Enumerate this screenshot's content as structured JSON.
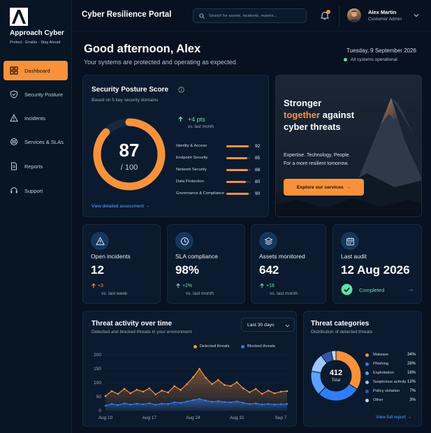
{
  "brand": {
    "name": "Approach Cyber",
    "tagline": "Protect  ·  Enable  ·  Stay Ahead"
  },
  "nav": [
    {
      "label": "Dashboard",
      "icon": "grid-icon",
      "active": true
    },
    {
      "label": "Security Posture",
      "icon": "shield-icon"
    },
    {
      "label": "Incidents",
      "icon": "warning-icon"
    },
    {
      "label": "Services & SLAs",
      "icon": "services-icon"
    },
    {
      "label": "Reports",
      "icon": "document-icon"
    },
    {
      "label": "Support",
      "icon": "headset-icon"
    }
  ],
  "header": {
    "title": "Cyber Resilience Portal",
    "search_placeholder": "Search for assets, incidents, reports...",
    "user_name": "Alex Martin",
    "user_role": "Customer Admin"
  },
  "greeting": {
    "title": "Good afternoon, Alex",
    "subtitle": "Your systems are protected and operating as expected.",
    "date": "Tuesday, 9 September 2026",
    "status": "All systems operational"
  },
  "posture": {
    "title": "Security Posture Score",
    "subtitle": "Based on 5 key security domains",
    "score": 87,
    "max": 100,
    "max_label": "/ 100",
    "delta": "+4 pts",
    "delta_comp": "vs. last month",
    "link": "View detailed assessment",
    "domains": [
      {
        "name": "Identity & Access",
        "value": 92
      },
      {
        "name": "Endpoint Security",
        "value": 85
      },
      {
        "name": "Network Security",
        "value": 88
      },
      {
        "name": "Data Protection",
        "value": 80
      },
      {
        "name": "Governance & Compliance",
        "value": 90
      }
    ]
  },
  "hero": {
    "line1": "Stronger",
    "line2_accent": "together",
    "line2_rest": " against",
    "line3": "cyber threats",
    "text1": "Expertise. Technology. People.",
    "text2": "For a more resilient tomorrow.",
    "button": "Explore our services"
  },
  "stats": [
    {
      "label": "Open incidents",
      "value": "12",
      "delta": "+3",
      "comp": "vs. last week",
      "icon": "warning-icon",
      "delta_color": "#f7923a",
      "delta_dir": "up"
    },
    {
      "label": "SLA compliance",
      "value": "98%",
      "delta": "+2%",
      "comp": "vs. last month",
      "icon": "clock-icon",
      "delta_color": "#5fe3a6",
      "delta_dir": "up"
    },
    {
      "label": "Assets monitored",
      "value": "642",
      "delta": "+18",
      "comp": "vs. last month",
      "icon": "layers-icon",
      "delta_color": "#5fe3a6",
      "delta_dir": "up"
    },
    {
      "label": "Last audit",
      "value": "12 Aug 2026",
      "status": "Completed",
      "icon": "calendar-icon"
    }
  ],
  "activity": {
    "title": "Threat activity over time",
    "subtitle": "Detected and blocked threats in your environment",
    "range": "Last 30 days"
  },
  "categories": {
    "title": "Threat categories",
    "subtitle": "Distribution of detected threats",
    "total": "412",
    "total_label": "Total",
    "link": "View full report",
    "items": [
      {
        "name": "Malware",
        "pct": 34,
        "label": "34%",
        "color": "#f7923a"
      },
      {
        "name": "Phishing",
        "pct": 28,
        "label": "28%",
        "color": "#2f7df6"
      },
      {
        "name": "Exploitation",
        "pct": 16,
        "label": "16%",
        "color": "#5aa2ff"
      },
      {
        "name": "Suspicious activity",
        "pct": 12,
        "label": "12%",
        "color": "#9cc7ff"
      },
      {
        "name": "Policy violation",
        "pct": 7,
        "label": "7%",
        "color": "#3358a8"
      },
      {
        "name": "Other",
        "pct": 3,
        "label": "3%",
        "color": "#c9d4e6"
      }
    ]
  },
  "chart_data": {
    "type": "area",
    "title": "Threat activity over time",
    "x": [
      "Aug 10",
      "",
      "",
      "",
      "",
      "",
      "",
      "Aug 17",
      "",
      "",
      "",
      "",
      "",
      "",
      "Aug 24",
      "",
      "",
      "",
      "",
      "",
      "",
      "Aug 31",
      "",
      "",
      "",
      "",
      "",
      "",
      "Sep 7",
      ""
    ],
    "x_tick_labels": [
      "Aug 10",
      "Aug 17",
      "Aug 24",
      "Aug 31",
      "Sep 7"
    ],
    "y_ticks": [
      0,
      50,
      100,
      150,
      200
    ],
    "ylim": [
      0,
      200
    ],
    "legend_position": "top-right",
    "series": [
      {
        "name": "Detected threats",
        "color": "#f7923a",
        "values": [
          52,
          70,
          60,
          78,
          62,
          75,
          68,
          80,
          58,
          72,
          65,
          88,
          74,
          95,
          120,
          150,
          118,
          95,
          110,
          92,
          88,
          102,
          80,
          66,
          78,
          60,
          72,
          62,
          68,
          70
        ]
      },
      {
        "name": "Blocked threats",
        "color": "#2f7df6",
        "values": [
          18,
          24,
          20,
          26,
          22,
          25,
          23,
          27,
          21,
          25,
          24,
          30,
          28,
          33,
          38,
          42,
          36,
          32,
          34,
          31,
          30,
          33,
          28,
          24,
          26,
          22,
          24,
          22,
          23,
          24
        ]
      }
    ]
  }
}
